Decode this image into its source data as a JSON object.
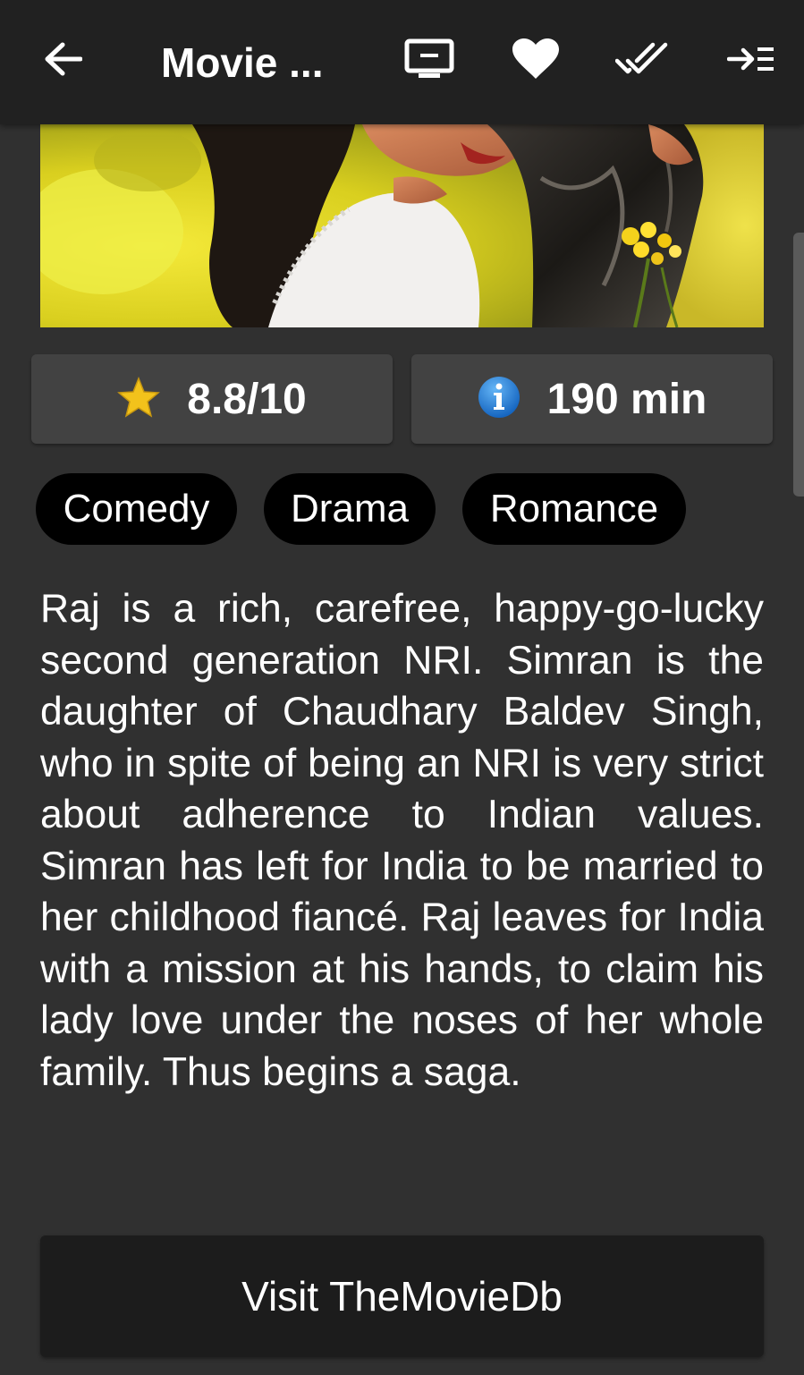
{
  "appbar": {
    "title": "Movie ...",
    "icons": {
      "back": "arrow-left-icon",
      "watch": "tv-icon",
      "favorite": "heart-icon",
      "watched": "double-check-icon",
      "add_to_list": "add-to-list-icon"
    }
  },
  "poster": {
    "image": "movie-poster"
  },
  "info": {
    "rating": "8.8/10",
    "runtime": "190 min",
    "rating_icon": "star-icon",
    "runtime_icon": "info-icon"
  },
  "genres": [
    "Comedy",
    "Drama",
    "Romance"
  ],
  "overview": "Raj is a rich, carefree, happy-go-lucky second generation NRI. Simran is the daughter of Chaudhary Baldev Singh, who in spite of being an NRI is very strict about adherence to Indian values. Simran has left for India to be married to her childhood fiancé. Raj leaves for India with a mission at his hands, to claim his lady love under the noses of her whole family. Thus begins a saga.",
  "visit_button": "Visit TheMovieDb",
  "colors": {
    "appbar": "#212121",
    "background": "#303030",
    "card": "#424242",
    "chip": "#000000",
    "star": "#f2c21b",
    "info_blue": "#1e88e5"
  }
}
